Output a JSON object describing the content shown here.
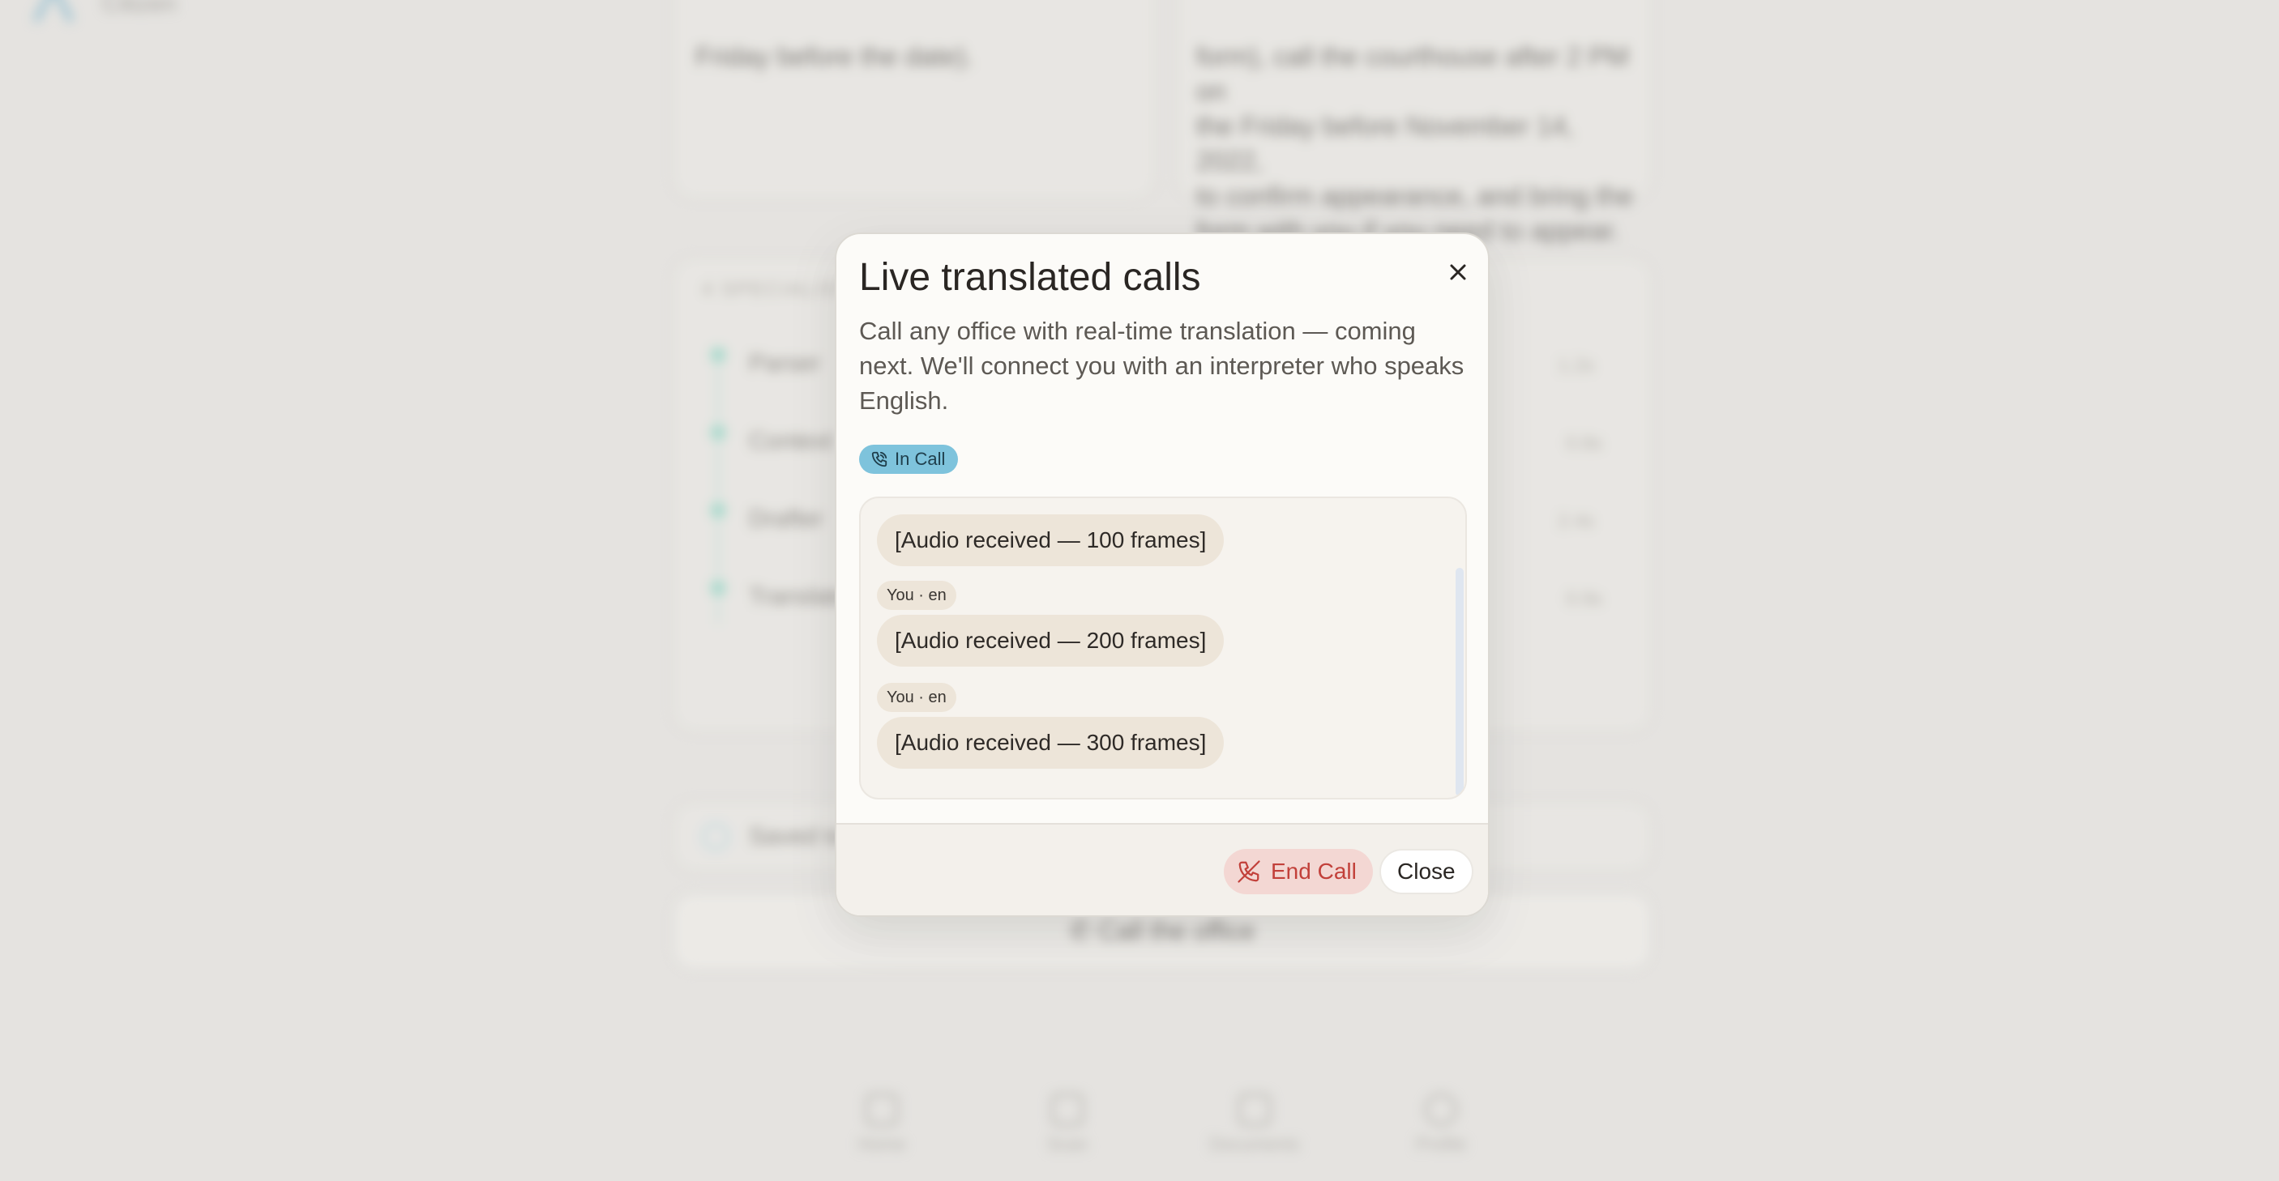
{
  "background": {
    "app_name": "Citizen",
    "card_left_text": "Friday before the date).",
    "card_right_text": [
      "form), call the courthouse after 2 PM on",
      "the Friday before November 14, 2022,",
      "to confirm appearance, and bring the",
      "form with you if you need to appear."
    ],
    "section_label": "4 SPECIALIST AGENTS",
    "steps": [
      {
        "label": "Parser",
        "time": "1.2s"
      },
      {
        "label": "Context",
        "time": "0.8s"
      },
      {
        "label": "Drafter",
        "time": "2.4s"
      },
      {
        "label": "Translator",
        "time": "0.9s"
      }
    ],
    "saved_label": "Saved to documents",
    "call_office_label": "Call the office",
    "nav": [
      "Home",
      "Scan",
      "Documents",
      "Profile"
    ]
  },
  "modal": {
    "title": "Live translated calls",
    "description": "Call any office with real-time translation — coming next. We'll connect you with an interpreter who speaks English.",
    "status_badge": "In Call",
    "transcript": [
      {
        "meta": "",
        "text": "[Audio received — 100 frames]"
      },
      {
        "meta": "You · en",
        "text": "[Audio received — 200 frames]"
      },
      {
        "meta": "You · en",
        "text": "[Audio received — 300 frames]"
      }
    ],
    "end_call_label": "End Call",
    "close_label": "Close"
  },
  "colors": {
    "badge_bg": "#7ec3dc",
    "end_call_text": "#c2403a",
    "end_call_bg": "#f3d7d3",
    "bubble_bg": "#ede5d9",
    "modal_bg": "#fcfbf8"
  },
  "icons": {
    "close": "close-icon",
    "badge": "phone-call-icon",
    "end_call": "phone-off-icon"
  }
}
